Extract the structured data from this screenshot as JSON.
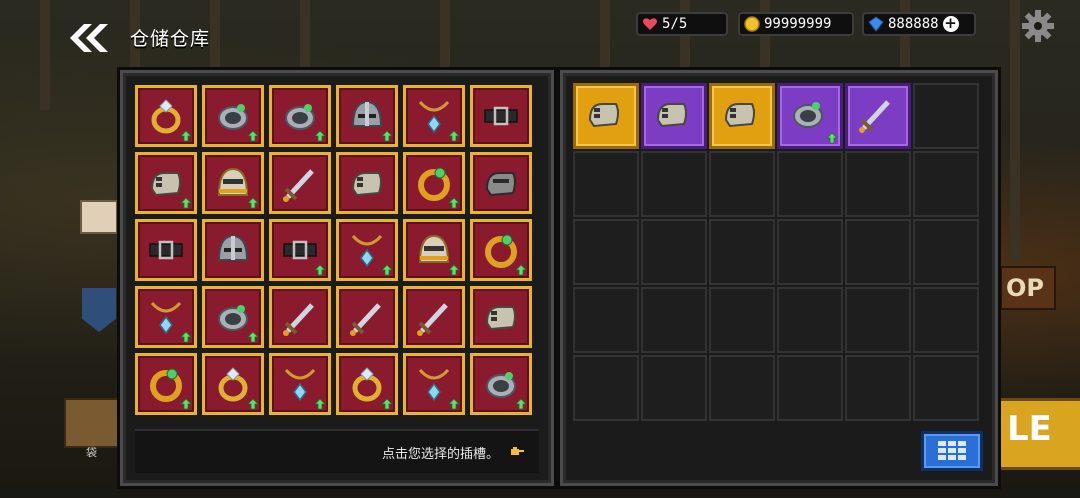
{
  "header": {
    "title": "仓储仓库",
    "back_icon": "double-chevron-left-icon",
    "settings_icon": "gear-icon"
  },
  "resources": {
    "hearts": {
      "text": "5/5",
      "icon": "heart-icon",
      "color": "#e84a5f"
    },
    "gold": {
      "text": "99999999",
      "icon": "coin-icon",
      "color": "#f2c12e"
    },
    "gems": {
      "text": "888888",
      "icon": "gem-icon",
      "color": "#3a8ee8",
      "add_icon": "plus-icon"
    }
  },
  "inventory": {
    "hint_text": "点击您选择的插槽。",
    "hint_icon": "pointing-hand-icon",
    "items": [
      {
        "icon": "ring",
        "upgradable": true
      },
      {
        "icon": "bracer",
        "upgradable": true
      },
      {
        "icon": "bracer",
        "upgradable": true
      },
      {
        "icon": "helmet",
        "upgradable": true
      },
      {
        "icon": "necklace",
        "upgradable": true
      },
      {
        "icon": "belt",
        "upgradable": false
      },
      {
        "icon": "gauntlet",
        "upgradable": true
      },
      {
        "icon": "helmet-gold",
        "upgradable": true
      },
      {
        "icon": "sword",
        "upgradable": false
      },
      {
        "icon": "gauntlet",
        "upgradable": false
      },
      {
        "icon": "ring-gold",
        "upgradable": true
      },
      {
        "icon": "gauntlet-dark",
        "upgradable": false
      },
      {
        "icon": "belt",
        "upgradable": false
      },
      {
        "icon": "helmet",
        "upgradable": false
      },
      {
        "icon": "belt",
        "upgradable": true
      },
      {
        "icon": "necklace",
        "upgradable": true
      },
      {
        "icon": "helmet-gold",
        "upgradable": true
      },
      {
        "icon": "ring-gold",
        "upgradable": true
      },
      {
        "icon": "necklace",
        "upgradable": true
      },
      {
        "icon": "bracer",
        "upgradable": true
      },
      {
        "icon": "sword",
        "upgradable": false
      },
      {
        "icon": "sword",
        "upgradable": false
      },
      {
        "icon": "sword",
        "upgradable": false
      },
      {
        "icon": "gauntlet",
        "upgradable": false
      },
      {
        "icon": "ring-gold",
        "upgradable": true
      },
      {
        "icon": "ring",
        "upgradable": true
      },
      {
        "icon": "necklace",
        "upgradable": true
      },
      {
        "icon": "ring",
        "upgradable": true
      },
      {
        "icon": "necklace",
        "upgradable": true
      },
      {
        "icon": "bracer",
        "upgradable": true
      }
    ]
  },
  "equipped": {
    "grid_button_icon": "grid-view-icon",
    "slots": [
      {
        "icon": "gauntlet",
        "rarity": "legendary",
        "upgradable": false
      },
      {
        "icon": "gauntlet",
        "rarity": "epic",
        "upgradable": false
      },
      {
        "icon": "gauntlet",
        "rarity": "legendary",
        "upgradable": false
      },
      {
        "icon": "bracer",
        "rarity": "epic",
        "upgradable": true
      },
      {
        "icon": "sword",
        "rarity": "epic",
        "upgradable": false
      }
    ],
    "total_slots": 30
  },
  "background": {
    "sign_text": "OP",
    "yellow_text": "LE",
    "left_text": "袋"
  }
}
